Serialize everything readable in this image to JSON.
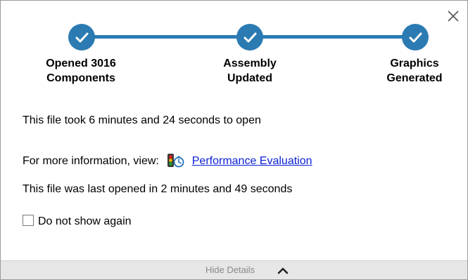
{
  "steps": [
    {
      "line1": "Opened 3016",
      "line2": "Components"
    },
    {
      "line1": "Assembly",
      "line2": "Updated"
    },
    {
      "line1": "Graphics",
      "line2": "Generated"
    }
  ],
  "info": {
    "open_time": "This file took 6 minutes and 24 seconds to open",
    "more_info_prefix": "For more information, view:",
    "link_label": "Performance Evaluation",
    "last_opened": "This file was last opened in 2 minutes and 49 seconds"
  },
  "checkbox": {
    "label": "Do not show again",
    "checked": false
  },
  "footer": {
    "label": "Hide Details",
    "icon": "chevron-up-icon"
  },
  "icons": {
    "close": "close-icon",
    "step": "checkmark-icon",
    "performance": "performance-evaluation-icon"
  },
  "colors": {
    "step_accent": "#2b7bb2",
    "link": "#0b1fd6",
    "footer_bg": "#e6e6e6",
    "footer_text": "#8a8a8a"
  }
}
